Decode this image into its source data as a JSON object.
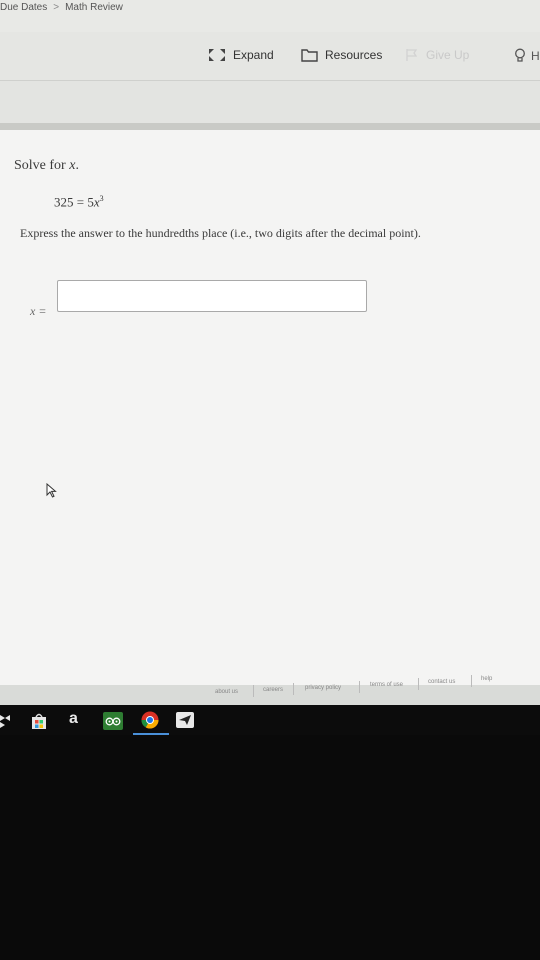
{
  "breadcrumb": {
    "items": [
      "Due Dates",
      "Math Review"
    ],
    "separator": ">"
  },
  "toolbar": {
    "expand_label": "Expand",
    "resources_label": "Resources",
    "give_up_label": "Give Up",
    "hint_label": "H"
  },
  "question": {
    "prompt_text": "Solve for ",
    "prompt_variable": "x",
    "prompt_end": ".",
    "equation_lhs": "325 = 5",
    "equation_var": "x",
    "equation_exponent": "3",
    "instruction": "Express the answer to the hundredths place (i.e., two digits after the decimal point).",
    "answer_label": "x =",
    "answer_value": ""
  },
  "footer": {
    "links": [
      "about us",
      "careers",
      "privacy policy",
      "terms of use",
      "contact us",
      "help"
    ]
  },
  "taskbar": {
    "icons": [
      "dropbox-icon",
      "store-icon",
      "amazon-icon",
      "tripadvisor-icon",
      "chrome-icon",
      "send-icon"
    ],
    "amazon_glyph": "a"
  },
  "colors": {
    "panel": "#f4f4f3",
    "toolbar": "#e5e6e3",
    "taskbar": "#0c0c0c",
    "active_indicator": "#4a90d9"
  }
}
